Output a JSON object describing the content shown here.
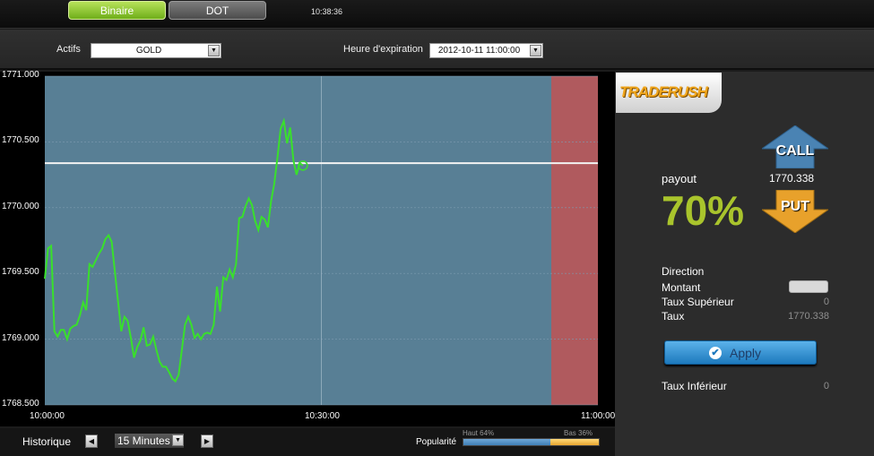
{
  "tabs": [
    {
      "label": "Binaire",
      "active": true
    },
    {
      "label": "DOT",
      "active": false
    }
  ],
  "clock": "10:38:36",
  "asset": {
    "label": "Actifs",
    "value": "GOLD"
  },
  "expiry": {
    "label": "Heure d'expiration",
    "value": "2012-10-11 11:00:00"
  },
  "chart_data": {
    "type": "line",
    "y_tick_labels": [
      "1771.000",
      "1770.500",
      "1770.000",
      "1769.500",
      "1769.000",
      "1768.500"
    ],
    "x_tick_labels": [
      "10:00:00",
      "10:30:00",
      "11:00:00"
    ],
    "ylim": [
      1768.5,
      1771.0
    ],
    "series_color": "#39e02b",
    "background": "#587f95",
    "expiry_zone_color": "#b05a5e",
    "reference_value": 1770.338,
    "x_minutes": [
      0,
      1,
      2,
      3,
      4,
      5,
      6,
      7,
      8,
      9,
      10,
      11,
      12,
      13,
      14,
      15,
      16,
      17,
      18,
      19,
      20,
      21,
      22,
      23,
      24,
      25,
      26,
      27,
      28,
      29,
      30,
      31,
      32,
      33,
      34,
      35,
      36,
      37,
      38,
      39,
      40,
      41,
      42,
      43,
      44,
      45,
      46,
      47,
      48,
      49,
      50,
      51,
      52,
      53,
      54,
      55,
      56,
      57,
      58,
      59,
      60,
      61,
      62,
      63,
      64,
      65,
      66,
      67,
      68,
      69,
      70,
      71,
      72,
      73,
      74,
      75,
      76,
      77,
      78,
      79,
      80,
      81,
      82,
      83,
      84,
      85,
      86,
      87,
      88,
      89,
      90,
      91,
      92,
      93,
      94,
      95,
      96,
      97,
      98,
      99,
      100
    ],
    "values": [
      1769.46,
      1769.69,
      1769.71,
      1769.06,
      1769.02,
      1769.07,
      1769.07,
      1769.0,
      1769.08,
      1769.1,
      1769.11,
      1769.18,
      1769.28,
      1769.22,
      1769.57,
      1769.55,
      1769.6,
      1769.65,
      1769.69,
      1769.76,
      1769.79,
      1769.74,
      1769.51,
      1769.28,
      1769.06,
      1769.17,
      1769.14,
      1769.01,
      1768.86,
      1768.94,
      1768.99,
      1769.09,
      1768.95,
      1768.96,
      1769.02,
      1768.92,
      1768.83,
      1768.79,
      1768.79,
      1768.75,
      1768.7,
      1768.68,
      1768.73,
      1768.92,
      1769.11,
      1769.17,
      1769.11,
      1769.01,
      1769.04,
      1769.0,
      1769.04,
      1769.05,
      1769.04,
      1769.11,
      1769.4,
      1769.21,
      1769.47,
      1769.45,
      1769.53,
      1769.47,
      1769.57,
      1769.92,
      1769.93,
      1770.01,
      1770.07,
      1770.02,
      1769.9,
      1769.83,
      1769.93,
      1769.91,
      1769.85,
      1770.05,
      1770.18,
      1770.38,
      1770.6,
      1770.66,
      1770.49,
      1770.61,
      1770.36,
      1770.25,
      1770.34,
      1770.32
    ]
  },
  "bottom": {
    "history_label": "Historique",
    "period_value": "15 Minutes",
    "popularity_label": "Popularité",
    "haut_label": "Haut 64%",
    "bas_label": "Bas 36%",
    "haut_fraction": 0.64,
    "bas_fraction": 0.36
  },
  "panel": {
    "logo_text": "TRADERUSH",
    "payout_label": "payout",
    "payout_value": "1770.338",
    "payout_percent": "70%",
    "call_label": "CALL",
    "put_label": "PUT",
    "call_color": "#4a83b3",
    "put_color": "#e8a12b",
    "direction_label": "Direction",
    "montant_label": "Montant",
    "taux_sup_label": "Taux Supérieur",
    "taux_sup_value": "0",
    "taux_label": "Taux",
    "taux_value": "1770.338",
    "apply_label": "Apply",
    "taux_inf_label": "Taux Inférieur",
    "taux_inf_value": "0"
  }
}
